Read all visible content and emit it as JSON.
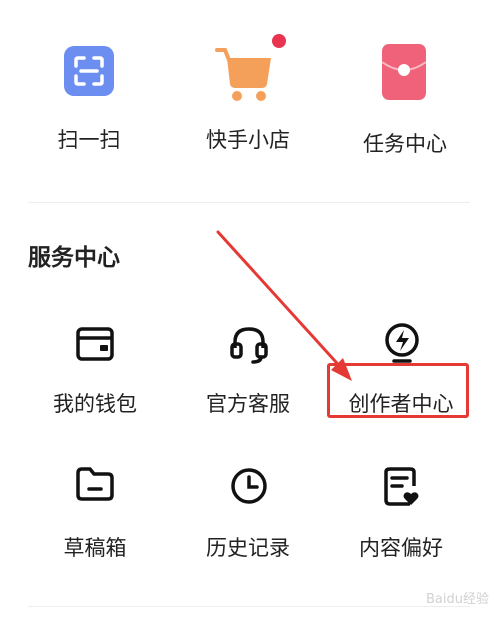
{
  "top_row": [
    {
      "label": "扫一扫",
      "icon": "scan-icon"
    },
    {
      "label": "快手小店",
      "icon": "shopping-cart-icon"
    },
    {
      "label": "任务中心",
      "icon": "red-envelope-icon"
    }
  ],
  "service_center": {
    "title": "服务中心",
    "row1": [
      {
        "label": "我的钱包",
        "icon": "wallet-icon"
      },
      {
        "label": "官方客服",
        "icon": "headset-icon"
      },
      {
        "label": "创作者中心",
        "icon": "lightning-bulb-icon"
      }
    ],
    "row2": [
      {
        "label": "草稿箱",
        "icon": "folder-icon"
      },
      {
        "label": "历史记录",
        "icon": "clock-icon"
      },
      {
        "label": "内容偏好",
        "icon": "document-heart-icon"
      }
    ]
  },
  "watermark": "Baidu经验",
  "colors": {
    "scan": "#6c8ef0",
    "cart": "#f5a05a",
    "badge": "#e8344e",
    "envelope": "#f0627a",
    "highlight": "#e53935"
  }
}
